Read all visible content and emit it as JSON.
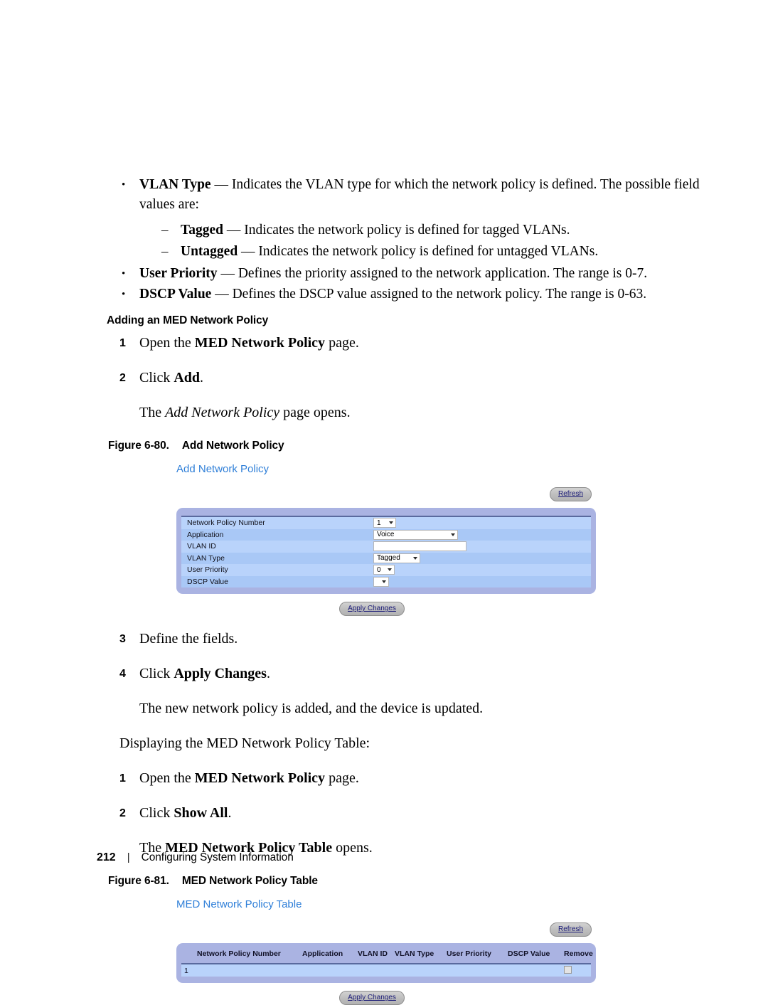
{
  "document": {
    "bullets": [
      {
        "marker": "•",
        "term": "VLAN Type",
        "dash": " — ",
        "text": "Indicates the VLAN type for which the network policy is defined. The possible field values are:"
      },
      {
        "marker": "–",
        "term": "Tagged",
        "dash": " — ",
        "text": "Indicates the network policy is defined for tagged VLANs."
      },
      {
        "marker": "–",
        "term": "Untagged",
        "dash": " — ",
        "text": "Indicates the network policy is defined for untagged VLANs."
      },
      {
        "marker": "•",
        "term": "User Priority",
        "dash": " — ",
        "text": "Defines the priority assigned to the network application. The range is 0-7."
      },
      {
        "marker": "•",
        "term": "DSCP Value",
        "dash": " — ",
        "text": "Defines the DSCP value assigned to the network policy. The range is 0-63."
      }
    ],
    "section_heading": "Adding an MED Network Policy",
    "steps_add": [
      {
        "num": "1",
        "pre": "Open the ",
        "bold": "MED Network Policy",
        "post": " page."
      },
      {
        "num": "2",
        "pre": "Click ",
        "bold": "Add",
        "post": "."
      }
    ],
    "add_result": {
      "pre": "The ",
      "italic": "Add Network Policy",
      "post": " page opens."
    },
    "figure_80": {
      "label": "Figure 6-80.",
      "title": "Add Network Policy"
    },
    "steps_define": [
      {
        "num": "3",
        "pre": "Define the fields.",
        "bold": "",
        "post": ""
      },
      {
        "num": "4",
        "pre": "Click ",
        "bold": "Apply Changes",
        "post": "."
      }
    ],
    "define_result": "The new network policy is added, and the device is updated.",
    "display_intro": "Displaying the MED Network Policy Table:",
    "steps_display": [
      {
        "num": "1",
        "pre": "Open the ",
        "bold": "MED Network Policy",
        "post": " page."
      },
      {
        "num": "2",
        "pre": "Click ",
        "bold": "Show All",
        "post": "."
      }
    ],
    "display_result": {
      "pre": "The ",
      "bold": "MED Network Policy Table",
      "post": " opens."
    },
    "figure_81": {
      "label": "Figure 6-81.",
      "title": "MED Network Policy Table"
    }
  },
  "add_network_policy_page": {
    "title": "Add Network Policy",
    "refresh_label": "Refresh",
    "apply_label": "Apply Changes",
    "fields": [
      {
        "label": "Network Policy Number",
        "control": "select",
        "value": "1"
      },
      {
        "label": "Application",
        "control": "select",
        "value": "Voice"
      },
      {
        "label": "VLAN ID",
        "control": "text",
        "value": ""
      },
      {
        "label": "VLAN Type",
        "control": "select",
        "value": "Tagged"
      },
      {
        "label": "User Priority",
        "control": "select",
        "value": "0"
      },
      {
        "label": "DSCP Value",
        "control": "select",
        "value": ""
      }
    ]
  },
  "med_network_policy_table_page": {
    "title": "MED Network Policy Table",
    "refresh_label": "Refresh",
    "apply_label": "Apply Changes",
    "columns": [
      "Network Policy Number",
      "Application",
      "VLAN ID",
      "VLAN Type",
      "User Priority",
      "DSCP Value",
      "Remove"
    ],
    "rows": [
      {
        "network_policy_number": "1",
        "application": "",
        "vlan_id": "",
        "vlan_type": "",
        "user_priority": "",
        "dscp_value": "",
        "remove_checked": false
      }
    ]
  },
  "footer": {
    "page_number": "212",
    "separator": "|",
    "title": "Configuring System Information"
  },
  "colors": {
    "link_blue": "#2f7fd8",
    "panel_periwinkle": "#aab3e2",
    "row_light": "#b9d3fb",
    "row_dark": "#a9c8f6",
    "rule_navy": "#5a6a9e"
  }
}
